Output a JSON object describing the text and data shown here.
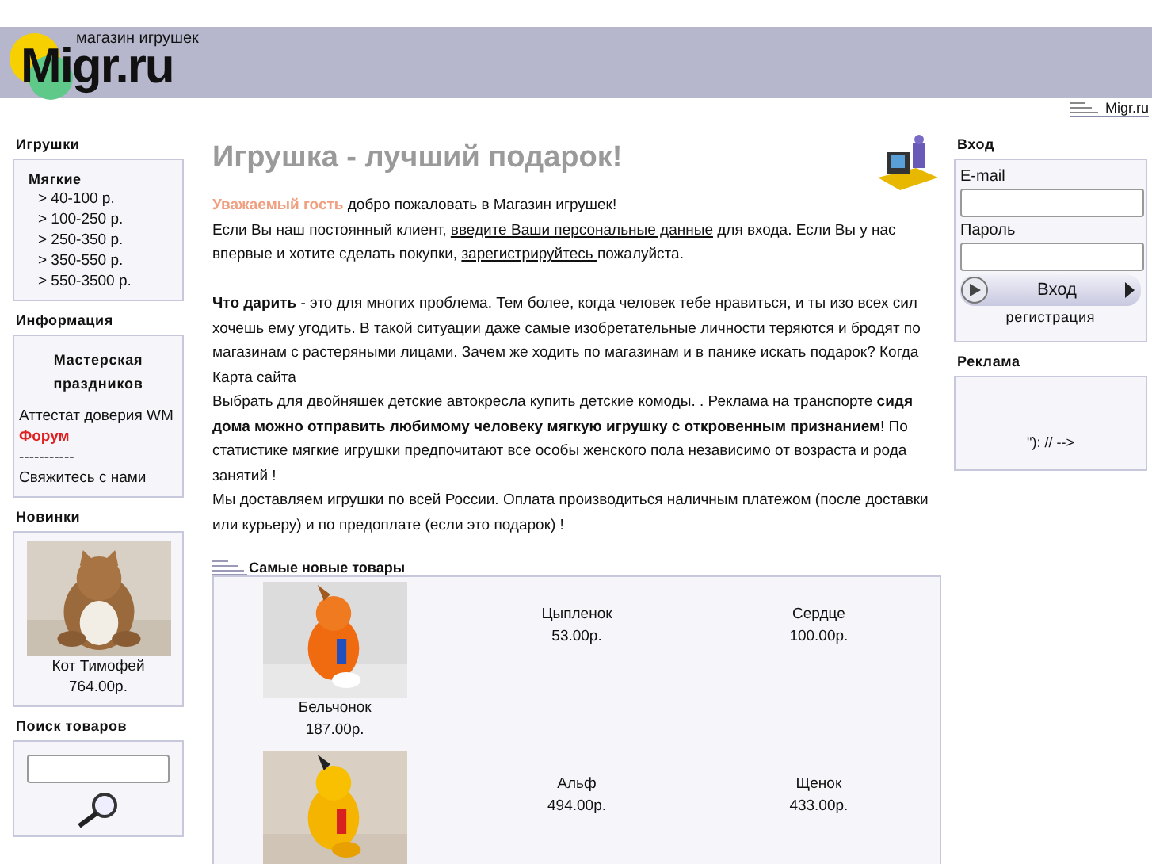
{
  "header": {
    "logo": "Migr.ru",
    "tagline": "магазин игрушек"
  },
  "top_link": "Migr.ru",
  "left": {
    "toys": {
      "title": "Игрушки",
      "category": "Мягкие",
      "items": [
        "> 40-100 р.",
        "> 100-250 р.",
        "> 250-350 р.",
        "> 350-550 р.",
        "> 550-3500 р."
      ]
    },
    "info": {
      "title": "Информация",
      "items": [
        {
          "kind": "bold",
          "text": "Мастерская праздников"
        },
        {
          "kind": "plain",
          "text": "Аттестат доверия WM"
        },
        {
          "kind": "accent",
          "text": "Форум"
        },
        {
          "kind": "plain",
          "text": "-----------"
        },
        {
          "kind": "plain",
          "text": "Свяжитесь с нами"
        }
      ]
    },
    "news": {
      "title": "Новинки",
      "name": "Кот Тимофей",
      "price": "764.00р."
    },
    "search": {
      "title": "Поиск товаров"
    }
  },
  "main": {
    "title": "Игрушка - лучший подарок!",
    "paragraphs": [
      {
        "spaced_before": false,
        "parts": [
          {
            "kind": "accent",
            "text": "Уважаемый гость"
          },
          {
            "kind": "text",
            "text": " добро пожаловать в Магазин игрушек!"
          }
        ]
      },
      {
        "spaced_before": false,
        "parts": [
          {
            "kind": "text",
            "text": "Если Вы наш постоянный клиент, "
          },
          {
            "kind": "link",
            "text": "введите Ваши персональные данные"
          },
          {
            "kind": "text",
            "text": " для входа. Если Вы у нас впервые и хотите сделать покупки, "
          },
          {
            "kind": "link",
            "text": "зарегистрируйтесь "
          },
          {
            "kind": "text",
            "text": "пожалуйста."
          }
        ]
      },
      {
        "spaced_before": true,
        "parts": [
          {
            "kind": "bold",
            "text": "Что дарить"
          },
          {
            "kind": "text",
            "text": " - это для многих проблема. Тем более, когда человек тебе нравиться, и ты изо всех сил хочешь ему угодить. В такой ситуации даже самые изобретательные личности теряются и бродят по магазинам с растеряными лицами. Зачем же ходить по магазинам и в панике искать подарок? Когда"
          }
        ]
      },
      {
        "spaced_before": false,
        "parts": [
          {
            "kind": "text",
            "text": "Карта сайта"
          }
        ]
      },
      {
        "spaced_before": false,
        "parts": [
          {
            "kind": "text",
            "text": "Выбрать для двойняшек детские автокресла купить детские комоды. . Реклама на транспорте "
          },
          {
            "kind": "bold",
            "text": "сидя дома можно отправить любимому человеку мягкую игрушку с откровенным признанием"
          },
          {
            "kind": "text",
            "text": "! По статистике мягкие игрушки предпочитают все особы женского пола независимо от возраста и рода занятий !"
          }
        ]
      },
      {
        "spaced_before": false,
        "parts": [
          {
            "kind": "text",
            "text": "Мы доставляем игрушки по всей России. Оплата производиться наличным платежом (после доставки или курьеру) и по предоплате (если это подарок) !"
          }
        ]
      }
    ],
    "products": {
      "title": "Самые новые товары",
      "rows": [
        [
          {
            "kind": "picture",
            "name": "Бельчонок",
            "price": "187.00р."
          },
          {
            "kind": "text",
            "name": "Цыпленок",
            "price": "53.00р."
          },
          {
            "kind": "text",
            "name": "Сердце",
            "price": "100.00р."
          }
        ],
        [
          {
            "kind": "picture"
          },
          {
            "kind": "text",
            "name": "Альф",
            "price": "494.00р."
          },
          {
            "kind": "text",
            "name": "Щенок",
            "price": "433.00р."
          }
        ]
      ]
    }
  },
  "right": {
    "login": {
      "title": "Вход",
      "email_label": "E-mail",
      "password_label": "Пароль",
      "button": "Вход",
      "register": "регистрация"
    },
    "ads": {
      "title": "Реклама",
      "text": "\"): // -->"
    }
  }
}
